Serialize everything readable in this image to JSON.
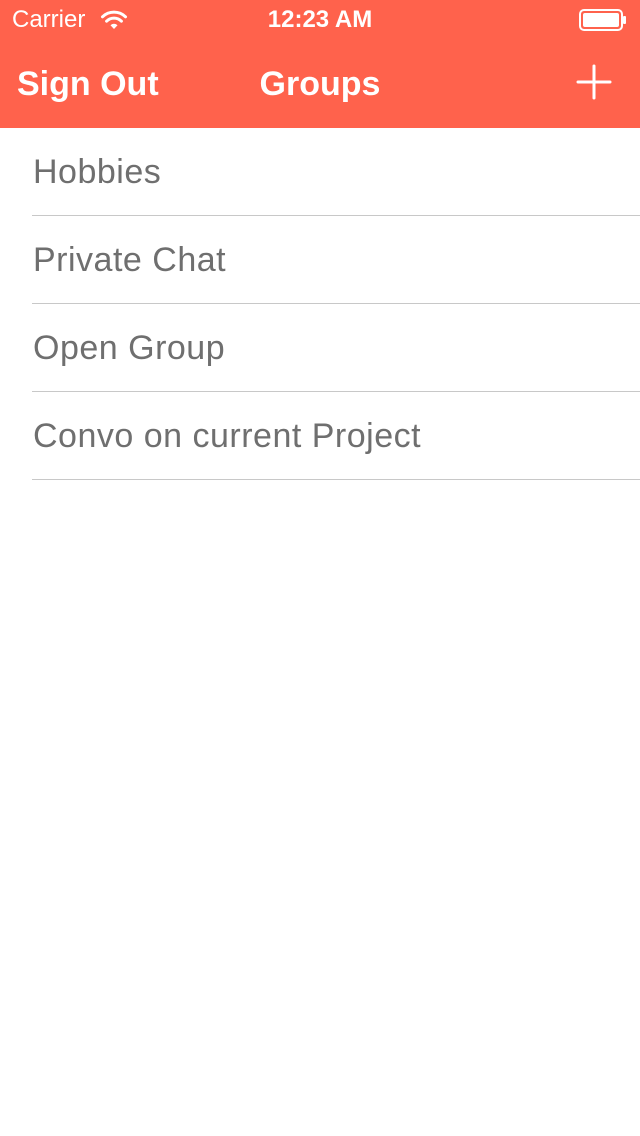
{
  "colors": {
    "accent": "#ff624c",
    "list_text": "#6f6f6f",
    "separator": "#c8c8c8",
    "background": "#ffffff"
  },
  "status_bar": {
    "carrier": "Carrier",
    "time": "12:23 AM",
    "icons": [
      "wifi-icon",
      "battery-icon"
    ]
  },
  "nav": {
    "left_button": "Sign Out",
    "title": "Groups",
    "right_icon": "plus-icon"
  },
  "groups": [
    {
      "name": "Hobbies"
    },
    {
      "name": "Private Chat"
    },
    {
      "name": "Open Group"
    },
    {
      "name": "Convo on current Project"
    }
  ]
}
